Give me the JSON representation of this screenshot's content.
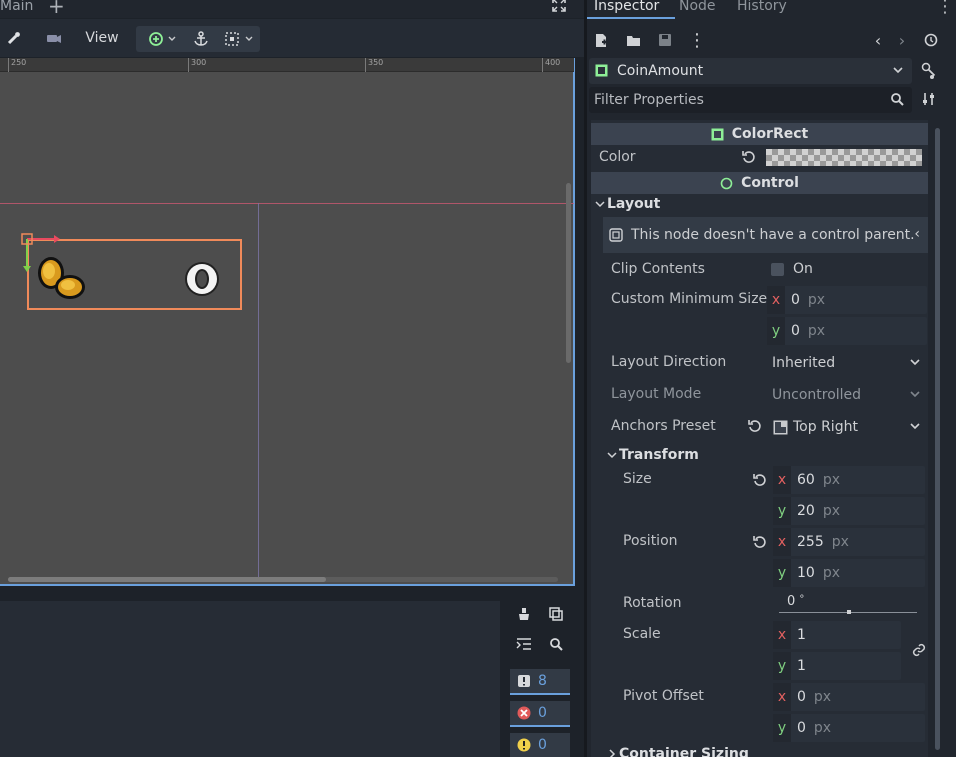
{
  "tabbar": {
    "main_label": "Main",
    "add_label": "+"
  },
  "toolbar": {
    "view_label": "View"
  },
  "ruler": {
    "ticks": [
      "250",
      "300",
      "350",
      "400"
    ]
  },
  "bottom": {
    "counters": [
      {
        "name": "messages",
        "value": "8",
        "color": "#d7d9dc"
      },
      {
        "name": "errors",
        "value": "0",
        "color": "#e05a5a"
      },
      {
        "name": "warnings",
        "value": "0",
        "color": "#f0d04a"
      }
    ]
  },
  "inspector": {
    "tabs": [
      "Inspector",
      "Node",
      "History"
    ],
    "node_name": "CoinAmount",
    "filter_placeholder": "Filter Properties",
    "sections": {
      "colorrect": "ColorRect",
      "control": "Control"
    },
    "color_label": "Color",
    "layout": {
      "title": "Layout",
      "warning": "This node doesn't have a control parent.",
      "clip_contents": {
        "label": "Clip Contents",
        "value": "On"
      },
      "custom_min_size": {
        "label": "Custom Minimum Size",
        "x": "0",
        "y": "0",
        "unit": "px"
      },
      "layout_direction": {
        "label": "Layout Direction",
        "value": "Inherited"
      },
      "layout_mode": {
        "label": "Layout Mode",
        "value": "Uncontrolled"
      },
      "anchors_preset": {
        "label": "Anchors Preset",
        "value": "Top Right"
      }
    },
    "transform": {
      "title": "Transform",
      "size": {
        "label": "Size",
        "x": "60",
        "y": "20",
        "unit": "px"
      },
      "position": {
        "label": "Position",
        "x": "255",
        "y": "10",
        "unit": "px"
      },
      "rotation": {
        "label": "Rotation",
        "value": "0",
        "unit": "°"
      },
      "scale": {
        "label": "Scale",
        "x": "1",
        "y": "1"
      },
      "pivot_offset": {
        "label": "Pivot Offset",
        "x": "0",
        "y": "0",
        "unit": "px"
      }
    },
    "container_sizing": "Container Sizing"
  },
  "axis_labels": {
    "x": "x",
    "y": "y"
  },
  "colors": {
    "accent": "#6aa0dd",
    "selection": "#f08a5a",
    "node_green": "#8eef97"
  }
}
